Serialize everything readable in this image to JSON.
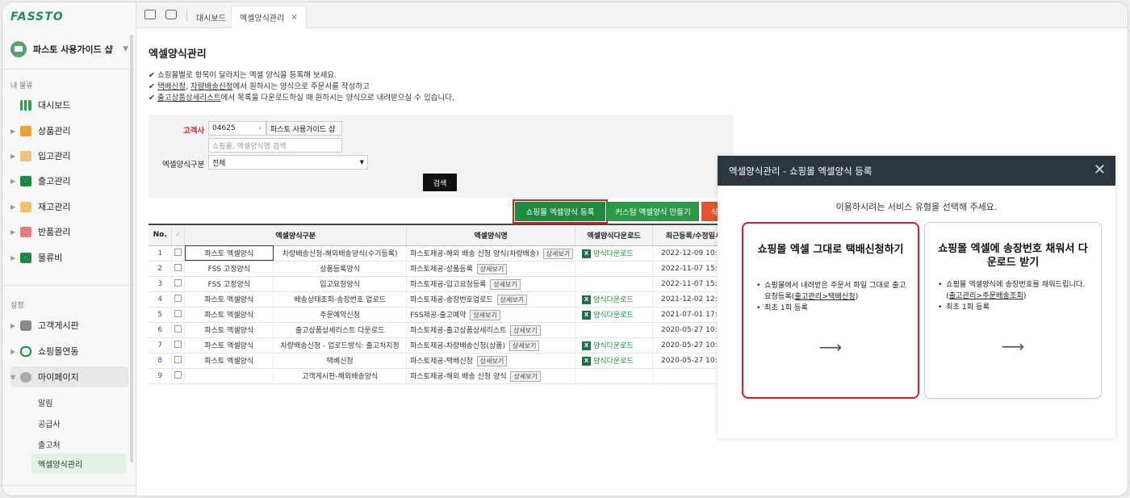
{
  "brand": {
    "logo": "FASSTO"
  },
  "sidebar": {
    "shop_name": "파스토 사용가이드 샵",
    "section1": "내 물류",
    "items": [
      {
        "label": "대시보드",
        "icon": "bar-chart-icon",
        "color": "#2e9f4c"
      },
      {
        "label": "상품관리",
        "icon": "box-icon",
        "color": "#e8a43a"
      },
      {
        "label": "입고관리",
        "icon": "cart-icon",
        "color": "#e8a43a"
      },
      {
        "label": "출고관리",
        "icon": "truck-icon",
        "color": "#1e8a3e"
      },
      {
        "label": "재고관리",
        "icon": "boxes-icon",
        "color": "#e8a43a"
      },
      {
        "label": "반품관리",
        "icon": "return-icon",
        "color": "#e55"
      },
      {
        "label": "물류비",
        "icon": "book-icon",
        "color": "#1e8a3e"
      }
    ],
    "section2": "설정",
    "settings": [
      {
        "label": "고객게시판",
        "icon": "chat-icon"
      },
      {
        "label": "쇼핑몰연동",
        "icon": "link-icon"
      },
      {
        "label": "마이페이지",
        "icon": "user-icon"
      }
    ],
    "subitems": [
      "알림",
      "공급사",
      "출고처",
      "엑셀양식관리"
    ]
  },
  "topbar": {
    "tabs": [
      {
        "label": "대시보드"
      },
      {
        "label": "엑셀양식관리"
      }
    ],
    "close": "×"
  },
  "page": {
    "title": "엑셀양식관리",
    "notes": [
      {
        "pre": "✔ 쇼핑몰별로 항목이 달라지는 엑셀 양식을 등록해 보세요.",
        "u1": "",
        "mid": "",
        "u2": "",
        "post": ""
      },
      {
        "pre": "✔ ",
        "u1": "택배신청",
        "mid": ", ",
        "u2": "차량배송신청",
        "post": "에서 원하시는 양식으로 주문서를 작성하고"
      },
      {
        "pre": "✔ ",
        "u1": "출고상품상세리스트",
        "mid": "",
        "u2": "",
        "post": "에서 목록을 다운로드하실 때 원하시는 양식으로 내려받으실 수 있습니다."
      }
    ]
  },
  "filter": {
    "customer_label": "고객사",
    "customer_code": "04625",
    "customer_name": "파스토 사용가이드 샵",
    "search_placeholder": "쇼핑몰, 엑셀양식명 검색",
    "type_label": "엑셀양식구분",
    "type_value": "전체",
    "search_button": "검색"
  },
  "actions": {
    "register": "쇼핑몰 엑셀양식 등록",
    "custom": "커스텀 엑셀양식 만들기",
    "delete": "삭"
  },
  "table": {
    "headers": [
      "No.",
      "✓",
      "엑셀양식구분",
      "엑셀양식명",
      "엑셀양식다운로드",
      "최근등록/수정일시"
    ],
    "detail_label": "상세보기",
    "download_label": "양식다운로드",
    "rows": [
      {
        "no": "1",
        "type": "파스토 엑셀양식",
        "sub": "차량배송신청-해외배송양식(수기등록)",
        "name": "파스토제공-해외 배송 신청 양식(차량배송)",
        "dl": true,
        "date": "2022-12-09 10:37"
      },
      {
        "no": "2",
        "type": "FSS 고정양식",
        "sub": "상품등록양식",
        "name": "파스토제공-상품등록",
        "dl": false,
        "date": "2022-11-07 15:4"
      },
      {
        "no": "3",
        "type": "FSS 고정양식",
        "sub": "입고요청양식",
        "name": "파스토제공-입고요청등록",
        "dl": false,
        "date": "2022-11-07 15:4"
      },
      {
        "no": "4",
        "type": "파스토 엑셀양식",
        "sub": "배송상태조회-송장번호 업로드",
        "name": "파스토제공-송장번호업로드",
        "dl": true,
        "date": "2021-12-02 12:5"
      },
      {
        "no": "5",
        "type": "파스토 엑셀양식",
        "sub": "주문예약신청",
        "name": "FSS제공-출고예약",
        "dl": true,
        "date": "2021-07-01 17:3"
      },
      {
        "no": "6",
        "type": "파스토 엑셀양식",
        "sub": "출고상품상세리스트 다운로드",
        "name": "파스토제공-출고상품상세리스트",
        "dl": false,
        "date": "2020-05-27 10:1"
      },
      {
        "no": "7",
        "type": "파스토 엑셀양식",
        "sub": "차량배송신청 - 업로드방식: 출고처지정",
        "name": "파스토제공-차량배송신청(상품)",
        "dl": true,
        "date": "2020-05-27 10:1"
      },
      {
        "no": "8",
        "type": "파스토 엑셀양식",
        "sub": "택배신청",
        "name": "파스토제공-택배신청",
        "dl": true,
        "date": "2020-05-27 10:1"
      },
      {
        "no": "9",
        "type": "",
        "sub": "고객게시판-해외배송양식",
        "name": "파스토제공-해외 배송 신청 양식",
        "dl": false,
        "date": ""
      }
    ]
  },
  "modal": {
    "title": "엑셀양식관리 - 쇼핑몰 엑셀양식 등록",
    "close": "✕",
    "subtitle": "이용하시려는 서비스 유형을 선택해 주세요.",
    "cards": [
      {
        "title": "쇼핑몰 엑셀 그대로 택배신청하기",
        "b1_pre": "쇼핑몰에서 내려받은 주문서 파일 그대로 출고요청등록(",
        "b1_link": "출고관리>택배신청",
        "b1_post": ")",
        "b2": "최초 1회 등록",
        "arrow": "⟶"
      },
      {
        "title": "쇼핑몰 엑셀에 송장번호 채워서 다운로드 받기",
        "b1_pre": "쇼핑몰 엑셀양식에 송장번호를 채워드립니다.(",
        "b1_link": "출고관리>주문배송조회",
        "b1_post": ")",
        "b2": "최초 1회 등록",
        "arrow": "⟶"
      }
    ]
  },
  "colors": {
    "brand": "#1f8f4e",
    "register": "#1e8a3e",
    "custom": "#2a9a49",
    "delete": "#e0542e",
    "highlight": "#d42020",
    "modal_head": "#2d3540"
  }
}
